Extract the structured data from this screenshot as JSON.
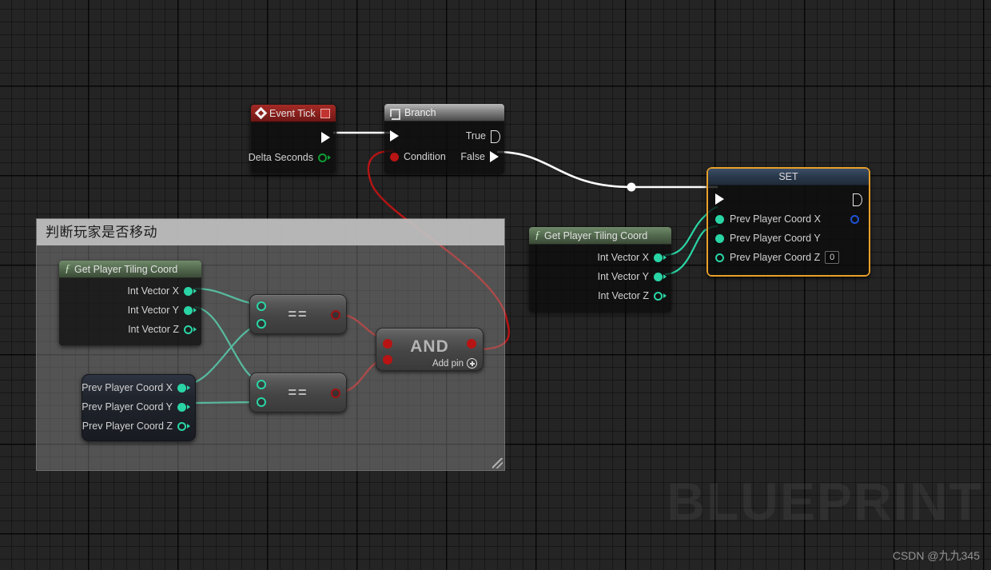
{
  "graph": {
    "watermark_large": "BLUEPRINT",
    "watermark_small": "CSDN @九九345",
    "accent_selected": "#e9a02a",
    "exec_wire_color": "#ffffff",
    "bool_wire_color": "#b81414",
    "int_wire_color": "#2ad5a5"
  },
  "comment": {
    "title": "判断玩家是否移动"
  },
  "nodes": {
    "event_tick": {
      "title": "Event Tick",
      "icon": "event-diamond-icon",
      "corner_icon": "stop-square-icon",
      "outputs": [
        {
          "label": "Delta Seconds",
          "pin": "float-pin"
        }
      ]
    },
    "branch": {
      "title": "Branch",
      "icon": "branch-icon",
      "inputs": [
        {
          "label": "Condition",
          "pin": "bool-pin"
        }
      ],
      "outputs": [
        {
          "label": "True",
          "pin": "exec-pin"
        },
        {
          "label": "False",
          "pin": "exec-pin"
        }
      ]
    },
    "get_player_tiling_coord_left": {
      "title": "Get Player Tiling Coord",
      "icon": "function-f-icon",
      "outputs": [
        {
          "label": "Int Vector X",
          "pin": "int-pin-filled"
        },
        {
          "label": "Int Vector Y",
          "pin": "int-pin-filled"
        },
        {
          "label": "Int Vector Z",
          "pin": "int-pin-hollow"
        }
      ]
    },
    "get_player_tiling_coord_right": {
      "title": "Get Player Tiling Coord",
      "icon": "function-f-icon",
      "outputs": [
        {
          "label": "Int Vector X",
          "pin": "int-pin-filled"
        },
        {
          "label": "Int Vector Y",
          "pin": "int-pin-filled"
        },
        {
          "label": "Int Vector Z",
          "pin": "int-pin-hollow"
        }
      ]
    },
    "prev_player_coord_getter": {
      "outputs": [
        {
          "label": "Prev Player Coord X",
          "pin": "int-pin-filled"
        },
        {
          "label": "Prev Player Coord Y",
          "pin": "int-pin-filled"
        },
        {
          "label": "Prev Player Coord Z",
          "pin": "int-pin-hollow"
        }
      ]
    },
    "equal_top": {
      "title": "=="
    },
    "equal_bottom": {
      "title": "=="
    },
    "and_node": {
      "title": "AND",
      "add_pin_label": "Add pin"
    },
    "set_node": {
      "title": "SET",
      "selected": true,
      "inputs": [
        {
          "label": "Prev Player Coord X",
          "pin": "int-pin-filled",
          "value": null
        },
        {
          "label": "Prev Player Coord Y",
          "pin": "int-pin-filled",
          "value": null
        },
        {
          "label": "Prev Player Coord Z",
          "pin": "int-pin-hollow",
          "value": "0"
        }
      ]
    }
  }
}
